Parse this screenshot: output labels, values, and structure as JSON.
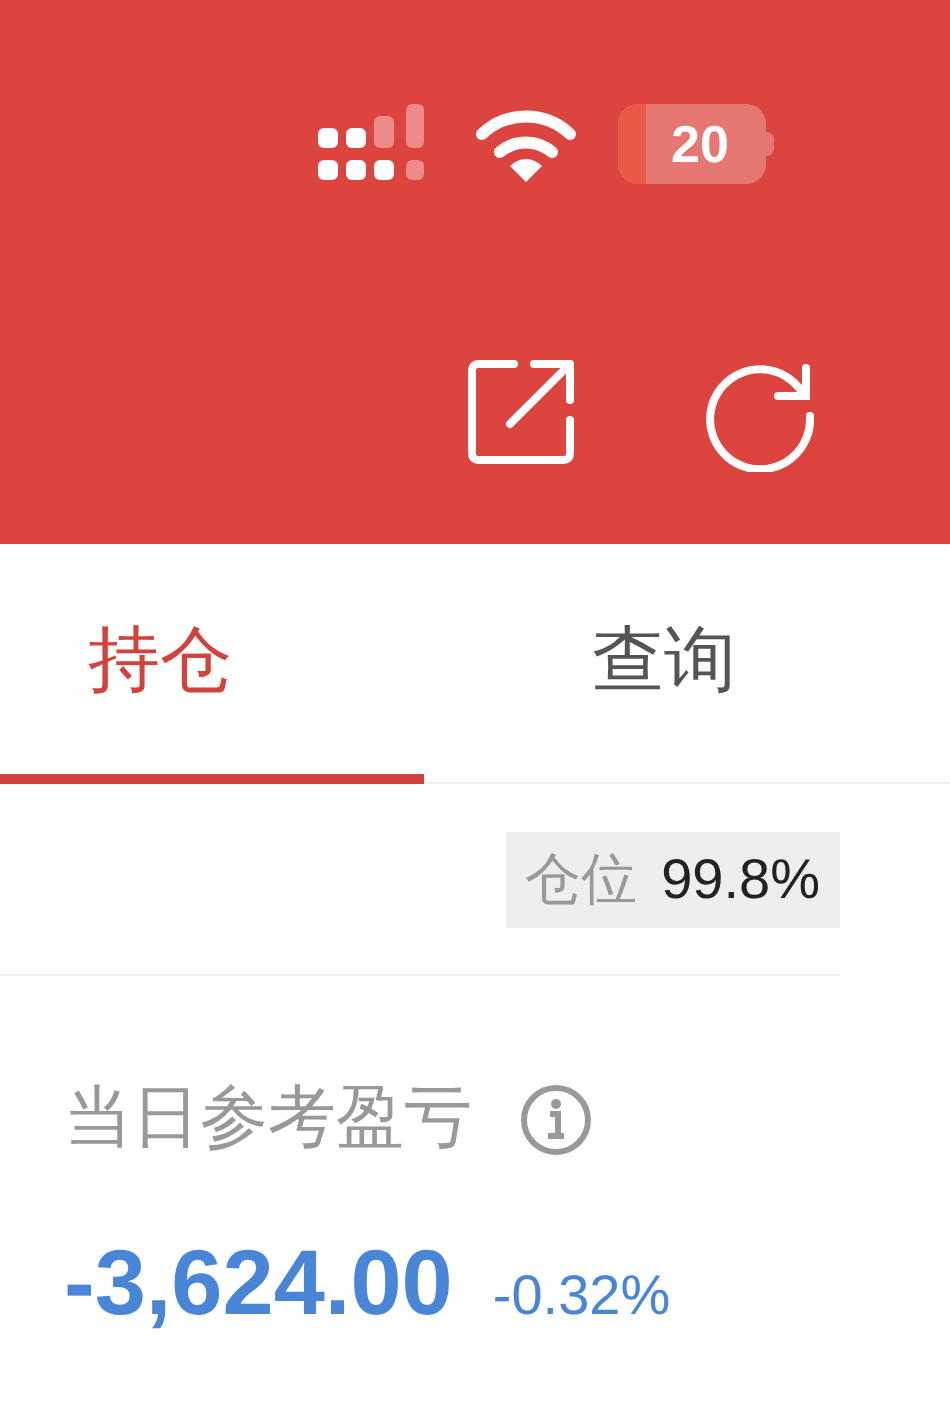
{
  "status_bar": {
    "battery": "20"
  },
  "tabs": [
    {
      "label": "持仓",
      "selected": true
    },
    {
      "label": "查询",
      "selected": false
    }
  ],
  "position": {
    "label": "仓位",
    "value": "99.8%"
  },
  "pnl": {
    "label": "当日参考盈亏",
    "value": "-3,624.00",
    "percent": "-0.32%"
  }
}
